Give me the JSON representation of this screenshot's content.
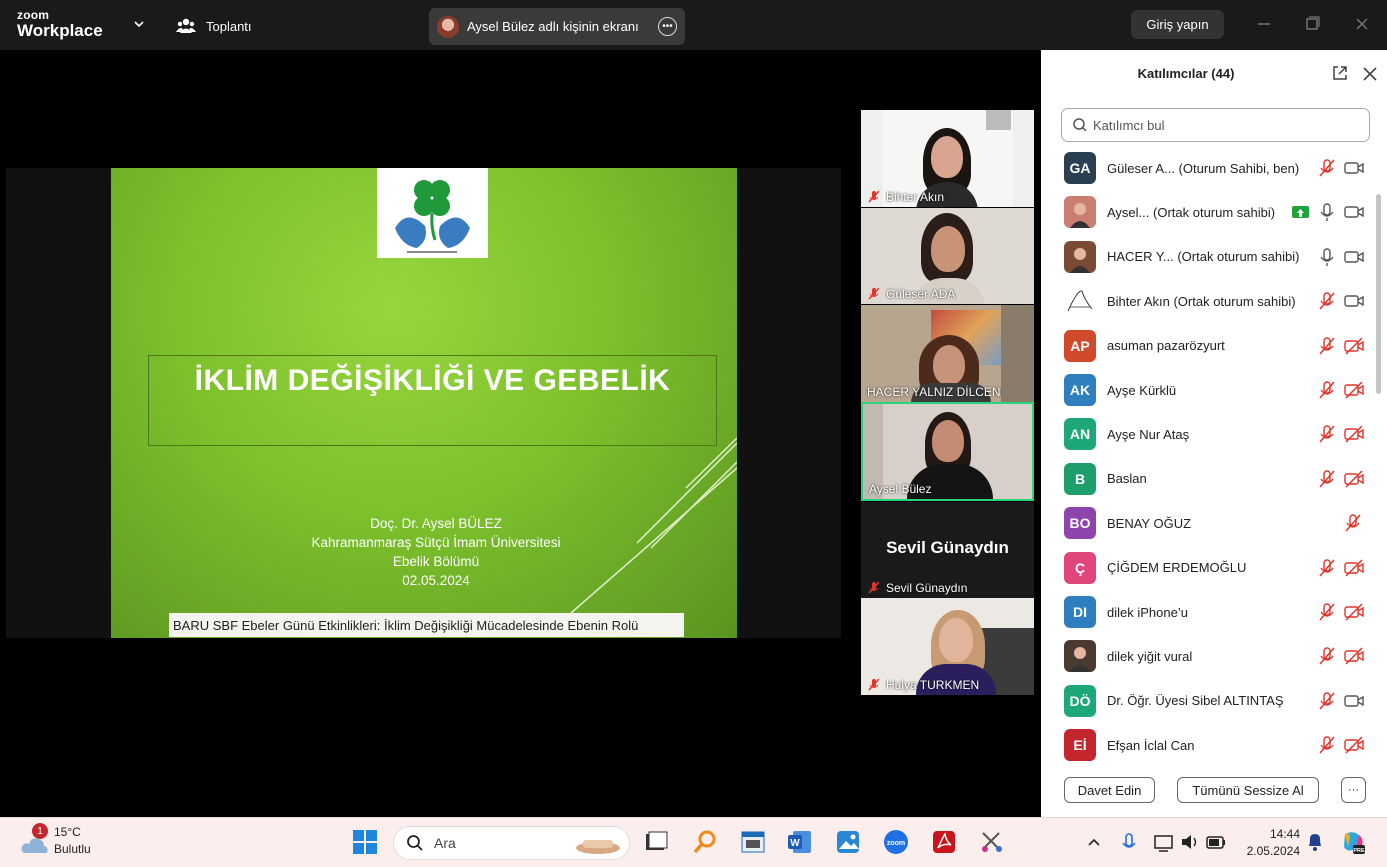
{
  "app": {
    "logo_top": "zoom",
    "logo_bottom": "Workplace",
    "meeting_label": "Toplantı",
    "share_label": "Aysel Bülez adlı kişinin ekranı",
    "login_label": "Giriş yapın"
  },
  "slide": {
    "title": "İKLİM DEĞİŞİKLİĞİ VE GEBELİK",
    "author": "Doç. Dr. Aysel BÜLEZ",
    "university": "Kahramanmaraş Sütçü İmam Üniversitesi",
    "department": "Ebelik Bölümü",
    "date": "02.05.2024",
    "caption": "BARU SBF Ebeler Günü Etkinlikleri: İklim Değişikliği Mücadelesinde Ebenin Rolü"
  },
  "video_tiles": [
    {
      "name": "Bihter Akın",
      "muted": true
    },
    {
      "name": "Güleser ADA",
      "muted": true
    },
    {
      "name": "HACER YALNIZ DİLCEN",
      "muted": false
    },
    {
      "name": "Aysel Bülez",
      "muted": false,
      "active": true
    },
    {
      "name": "Sevil Günaydın",
      "big_name": "Sevil Günaydın",
      "muted": true
    },
    {
      "name": "Hulya TURKMEN",
      "muted": true
    }
  ],
  "participants_panel": {
    "title": "Katılımcılar (44)",
    "search_placeholder": "Katılımcı bul",
    "participants": [
      {
        "initials": "GA",
        "name": "Güleser A...  (Oturum Sahibi, ben)",
        "color": "#2b3f52",
        "mic": "muted",
        "cam": "on"
      },
      {
        "initials": "",
        "name": "Aysel...  (Ortak oturum sahibi)",
        "color": "#c98070",
        "mic": "on",
        "cam": "on",
        "sharing": true
      },
      {
        "initials": "",
        "name": "HACER Y...  (Ortak oturum sahibi)",
        "color": "#7a4a34",
        "mic": "on",
        "cam": "on"
      },
      {
        "initials": "",
        "name": "Bihter Akın (Ortak oturum sahibi)",
        "color": "#ffffff",
        "mic": "muted",
        "cam": "on"
      },
      {
        "initials": "AP",
        "name": "asuman pazarözyurt",
        "color": "#d24a2c",
        "mic": "muted",
        "cam": "off"
      },
      {
        "initials": "AK",
        "name": "Ayşe Kürklü",
        "color": "#2f7fbf",
        "mic": "muted",
        "cam": "off"
      },
      {
        "initials": "AN",
        "name": "Ayşe Nur Ataş",
        "color": "#1ea87a",
        "mic": "muted",
        "cam": "off"
      },
      {
        "initials": "B",
        "name": "Baslan",
        "color": "#1e9e6a",
        "mic": "muted",
        "cam": "off"
      },
      {
        "initials": "BO",
        "name": "BENAY OĞUZ",
        "color": "#8e44ad",
        "mic": "muted",
        "cam": "none"
      },
      {
        "initials": "Ç",
        "name": "ÇİĞDEM ERDEMOĞLU",
        "color": "#e0457b",
        "mic": "muted",
        "cam": "off"
      },
      {
        "initials": "DI",
        "name": "dilek iPhone’u",
        "color": "#2f7fbf",
        "mic": "muted",
        "cam": "off"
      },
      {
        "initials": "",
        "name": "dilek yiğit vural",
        "color": "#4a3a30",
        "mic": "muted",
        "cam": "off"
      },
      {
        "initials": "DÖ",
        "name": "Dr. Öğr. Üyesi Sibel ALTINTAŞ",
        "color": "#1ea87a",
        "mic": "muted",
        "cam": "on"
      },
      {
        "initials": "Eİ",
        "name": "Efşan İclal Can",
        "color": "#c4262e",
        "mic": "muted",
        "cam": "off"
      }
    ],
    "invite_label": "Davet Edin",
    "mute_all_label": "Tümünü Sessize Al",
    "more_label": "···"
  },
  "taskbar": {
    "weather_badge": "1",
    "temperature": "15°C",
    "condition": "Bulutlu",
    "search_placeholder": "Ara",
    "time": "14:44",
    "date": "2.05.2024"
  }
}
